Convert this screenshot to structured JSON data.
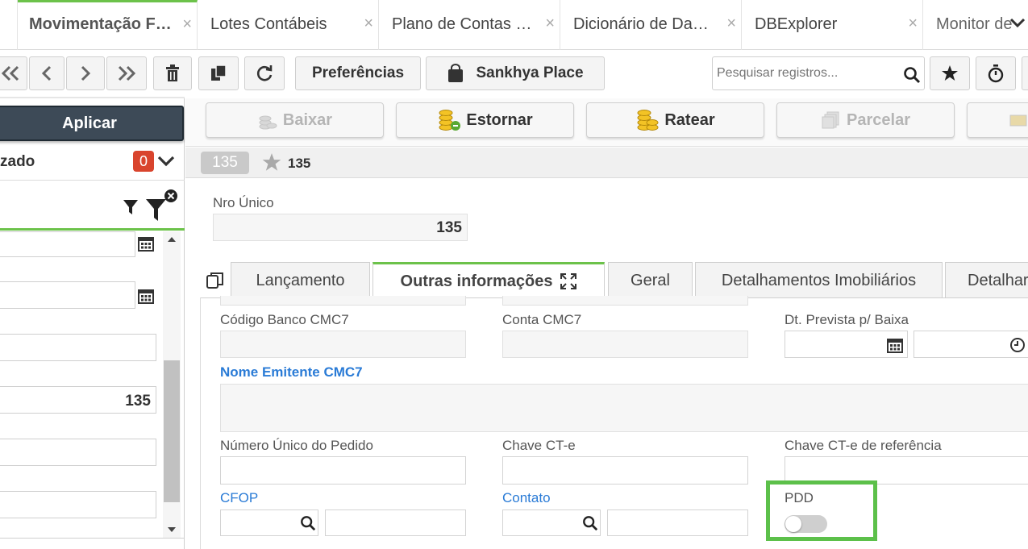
{
  "tabs": [
    {
      "label": "Movimentação F…",
      "close": "×"
    },
    {
      "label": "Lotes Contábeis",
      "close": "×"
    },
    {
      "label": "Plano de Contas …",
      "close": "×"
    },
    {
      "label": "Dicionário de Da…",
      "close": "×"
    },
    {
      "label": "DBExplorer",
      "close": "×"
    },
    {
      "label": "Monitor de",
      "close": ""
    }
  ],
  "toolbar": {
    "preferences_label": "Preferências",
    "sankhya_place_label": "Sankhya Place",
    "search_placeholder": "Pesquisar registros..."
  },
  "filter_panel": {
    "apply_label": "Aplicar",
    "status_label": "zado",
    "status_count": "0",
    "field_value": "135"
  },
  "actions": [
    {
      "label": "Baixar",
      "enabled": false
    },
    {
      "label": "Estornar",
      "enabled": true
    },
    {
      "label": "Ratear",
      "enabled": true
    },
    {
      "label": "Parcelar",
      "enabled": false
    }
  ],
  "record": {
    "badge": "135",
    "title": "135",
    "nro_unico_label": "Nro Único",
    "nro_unico_value": "135"
  },
  "form_tabs": [
    {
      "label": "Lançamento"
    },
    {
      "label": "Outras informações"
    },
    {
      "label": "Geral"
    },
    {
      "label": "Detalhamentos Imobiliários"
    },
    {
      "label": "Detalhar"
    }
  ],
  "fields": {
    "codigo_banco_cmc7": "Código Banco CMC7",
    "conta_cmc7": "Conta CMC7",
    "dt_prevista_baixa": "Dt. Prevista p/ Baixa",
    "nome_emitente_cmc7": "Nome Emitente CMC7",
    "numero_unico_pedido": "Número Único do Pedido",
    "chave_cte": "Chave CT-e",
    "chave_cte_referencia": "Chave CT-e de referência",
    "cfop": "CFOP",
    "contato": "Contato",
    "pdd": "PDD",
    "pdd_on": false
  },
  "colors": {
    "accent_green": "#6cc24a",
    "highlight_green": "#5cc04a",
    "link_blue": "#2a7bd6",
    "badge_red": "#d9442d",
    "apply_dark": "#3d4a57"
  }
}
